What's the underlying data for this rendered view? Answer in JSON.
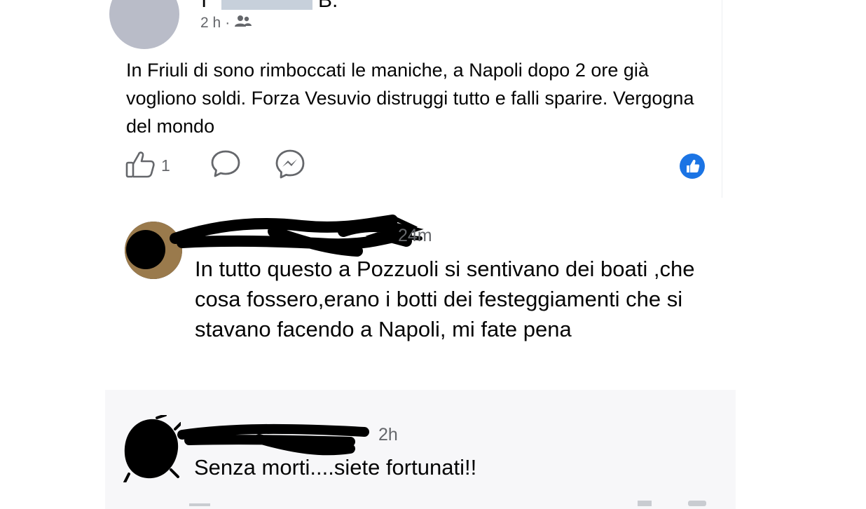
{
  "post": {
    "author_first_char": "T",
    "author_last_initial": "B.",
    "time": "2 h",
    "separator": "·",
    "audience_icon": "friends-icon",
    "close_icon": "close-icon",
    "text": "In Friuli di sono rimboccati le maniche, a Napoli dopo 2 ore già vogliono soldi. Forza Vesuvio distruggi tutto e falli sparire. Vergogna del mondo",
    "like_count": "1",
    "like_icon": "thumbs-up-icon",
    "comment_icon": "comment-icon",
    "messenger_icon": "messenger-icon",
    "reaction_badge_icon": "like-reaction-icon"
  },
  "comments": [
    {
      "time": "24m",
      "text": "In tutto questo a Pozzuoli si sentivano dei boati ,che cosa fossero,erano i botti dei festeggiamenti che si stavano facendo a Napoli, mi fate pena"
    },
    {
      "time": "2h",
      "text": "Senza morti....siete fortunati!!"
    }
  ],
  "colors": {
    "text_primary": "#050505",
    "text_secondary": "#65676b",
    "accent": "#1b74e4",
    "redaction_light": "#c7d0db",
    "scribble": "#000000"
  }
}
